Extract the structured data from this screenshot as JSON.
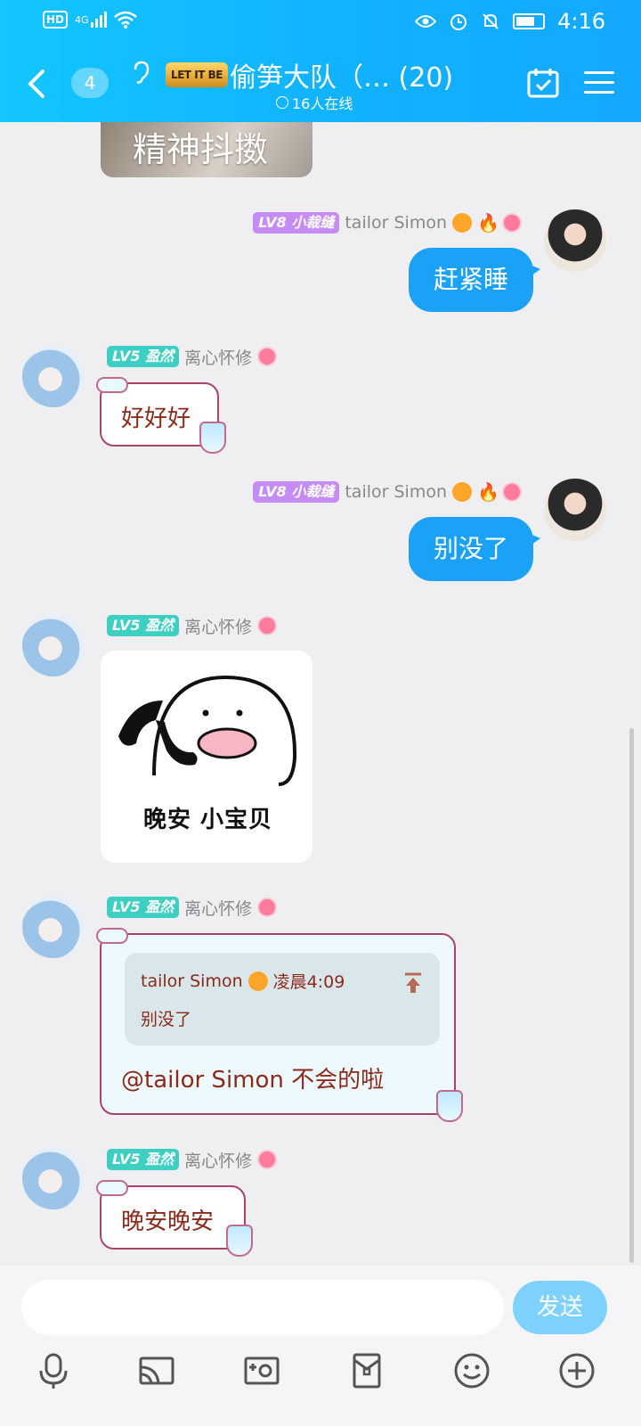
{
  "status_bar": {
    "hd": "HD",
    "network": "4G",
    "time": "4:16"
  },
  "header": {
    "back_count": "4",
    "logo_text": "LET IT BE",
    "title": "偷笋大队（…  (20)",
    "online": "16人在线"
  },
  "messages": {
    "top_image_text": "精神抖擞",
    "m1": {
      "level": "LV8",
      "tag": "小裁缝",
      "name": "tailor Simon",
      "text": "赶紧睡"
    },
    "m2": {
      "level": "LV5",
      "tag": "盈然",
      "name": "离心怀修",
      "text": "好好好"
    },
    "m3": {
      "level": "LV8",
      "tag": "小裁缝",
      "name": "tailor Simon",
      "text": "别没了"
    },
    "m4": {
      "level": "LV5",
      "tag": "盈然",
      "name": "离心怀修",
      "sticker_text": "晚安 小宝贝"
    },
    "m5": {
      "level": "LV5",
      "tag": "盈然",
      "name": "离心怀修",
      "quote_author": "tailor Simon",
      "quote_time": "凌晨4:09",
      "quote_text": "别没了",
      "text": "@tailor Simon  不会的啦"
    },
    "m6": {
      "level": "LV5",
      "tag": "盈然",
      "name": "离心怀修",
      "text": "晚安晚安"
    }
  },
  "input": {
    "placeholder": "",
    "send_label": "发送"
  },
  "toolbar_icons": [
    "microphone-icon",
    "screen-cast-icon",
    "photo-icon",
    "red-packet-icon",
    "emoji-icon",
    "plus-icon"
  ],
  "colors": {
    "header": "#11b0ff",
    "bubble_blue": "#1ba2f6",
    "send": "#7fd1ff"
  }
}
